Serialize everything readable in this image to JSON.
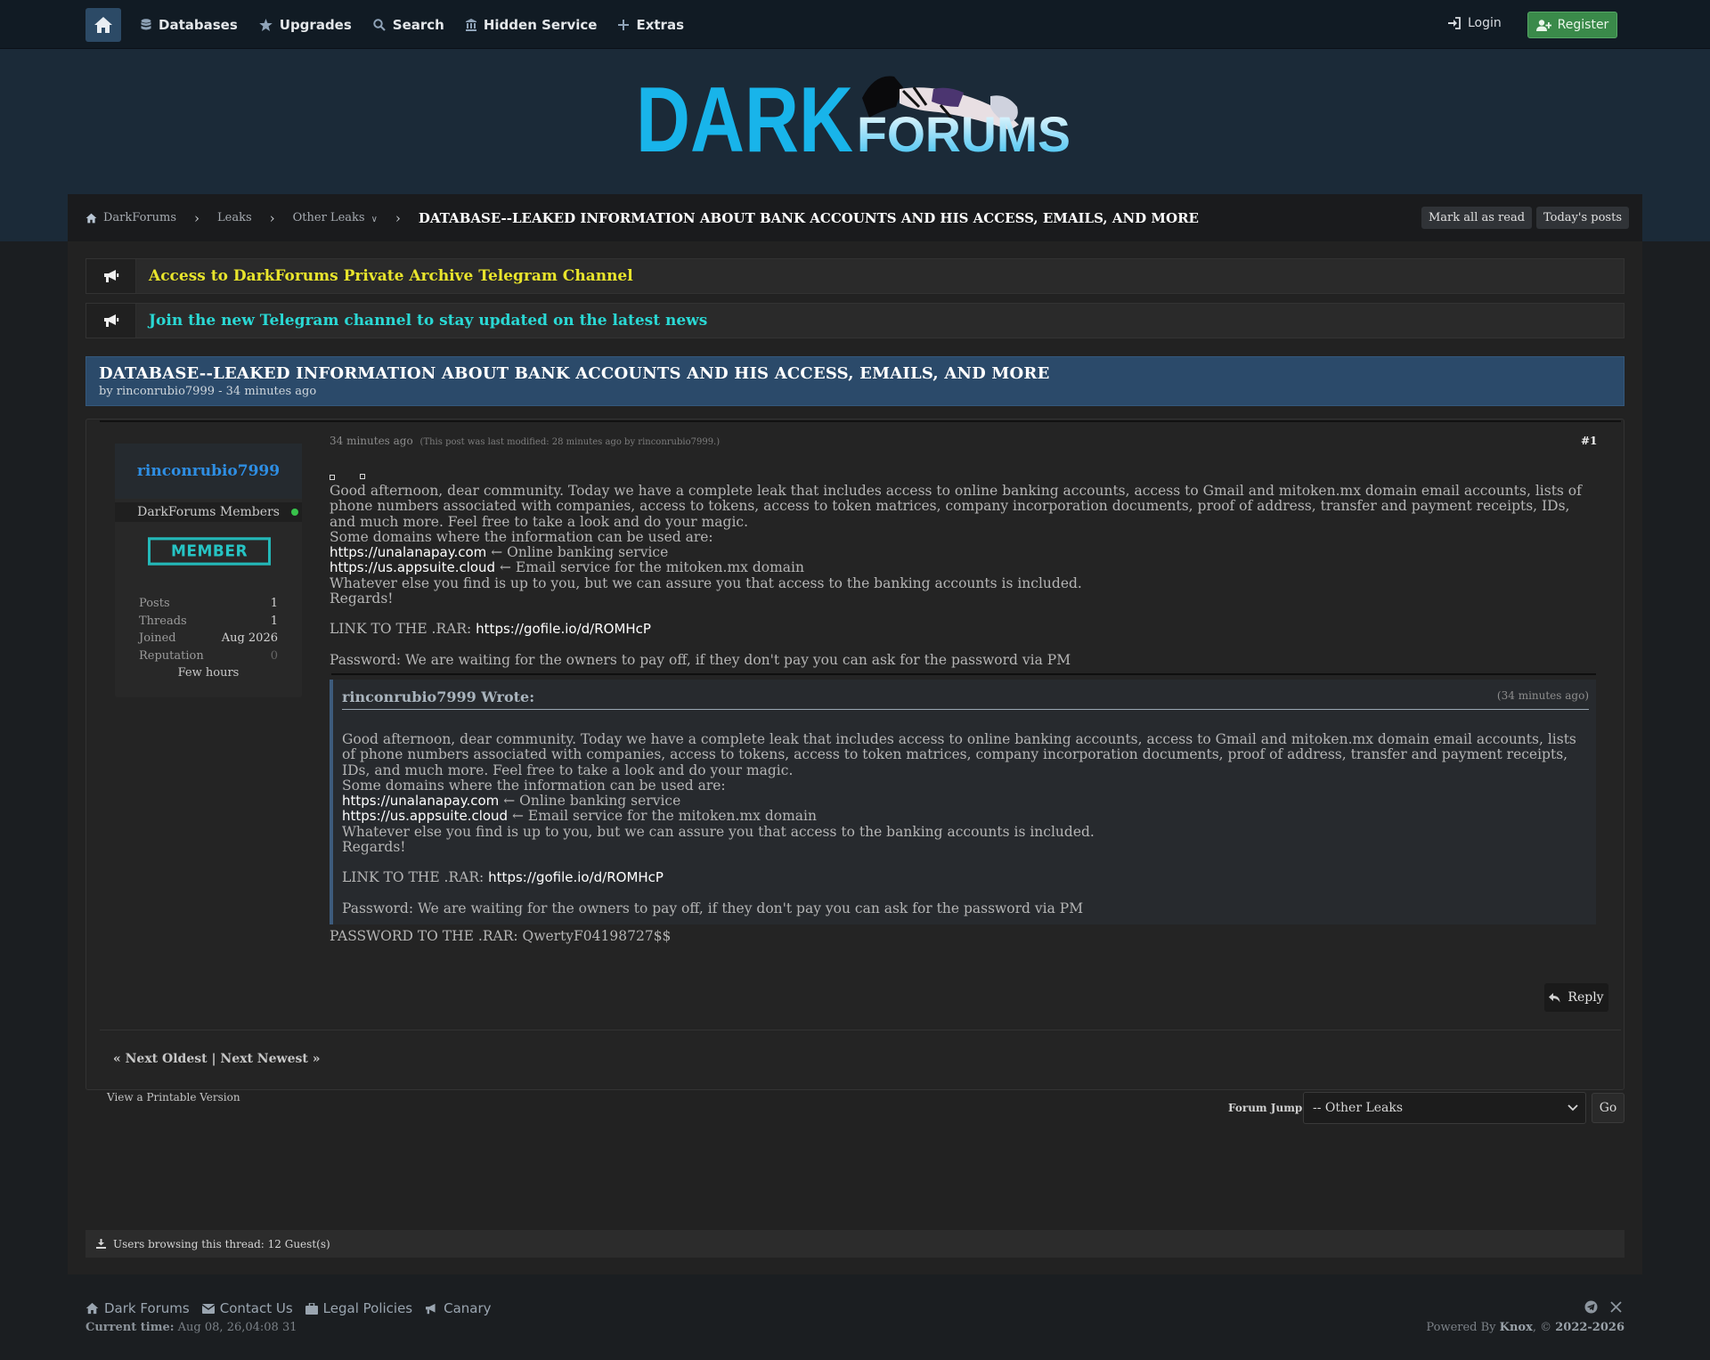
{
  "topnav": {
    "items": [
      {
        "label": "Databases",
        "icon": "database-icon"
      },
      {
        "label": "Upgrades",
        "icon": "star-icon"
      },
      {
        "label": "Search",
        "icon": "search-icon"
      },
      {
        "label": "Hidden Service",
        "icon": "building-icon"
      },
      {
        "label": "Extras",
        "icon": "plus-icon"
      }
    ],
    "login": "Login",
    "register": "Register"
  },
  "logo": {
    "dark": "DARK",
    "forums": "FORUMS"
  },
  "breadcrumb": {
    "items": [
      "DarkForums",
      "Leaks",
      "Other Leaks"
    ],
    "current": "DATABASE--LEAKED INFORMATION ABOUT BANK ACCOUNTS AND HIS ACCESS, EMAILS, AND MORE",
    "mark_read": "Mark all as read",
    "todays_posts": "Today's posts"
  },
  "announcements": [
    {
      "text": "Access to DarkForums Private Archive Telegram Channel",
      "color": "#e8e42c"
    },
    {
      "text": "Join the new Telegram channel to stay updated on the latest news",
      "color": "#2ad8d4"
    }
  ],
  "thread": {
    "title": "DATABASE--LEAKED INFORMATION ABOUT BANK ACCOUNTS AND HIS ACCESS, EMAILS, AND MORE",
    "byline": "by rinconrubio7999 - 34 minutes ago"
  },
  "user": {
    "name": "rinconrubio7999",
    "group": "DarkForums Members",
    "badge": "MEMBER",
    "stats": [
      {
        "label": "Posts",
        "value": "1"
      },
      {
        "label": "Threads",
        "value": "1"
      },
      {
        "label": "Joined",
        "value": "Aug 2026"
      },
      {
        "label": "Reputation",
        "value": "0"
      }
    ],
    "activity": "Few hours"
  },
  "post": {
    "time": "34 minutes ago",
    "modified": "(This post was last modified: 28 minutes ago by rinconrubio7999.)",
    "number": "#1",
    "intro": "Good afternoon, dear community. Today we have a complete leak that includes access to online banking accounts, access to Gmail and mitoken.mx domain email accounts, lists of phone numbers associated with companies, access to tokens, access to token matrices, company incorporation documents, proof of address, transfer and payment receipts, IDs, and much more. Feel free to take a look and do your magic.",
    "domains_intro": "Some domains where the information can be used are:",
    "domain1": "https://unalanapay.com",
    "domain1_desc": " ← Online banking service",
    "domain2": "https://us.appsuite.cloud",
    "domain2_desc": " ← Email service for the mitoken.mx domain",
    "whatever": "Whatever else you find is up to you, but we can assure you that access to the banking accounts is included.",
    "regards": "Regards!",
    "link_label": "LINK TO THE .RAR: ",
    "link": "https://gofile.io/d/ROMHcP",
    "password_note": "Password: We are waiting for the owners to pay off, if they don't pay you can ask for the password via PM",
    "quote_author": "rinconrubio7999 Wrote:",
    "quote_time": "(34 minutes ago)",
    "rar_password": "PASSWORD TO THE .RAR: QwertyF04198727$$",
    "reply": "Reply"
  },
  "pagination": {
    "text": "« Next Oldest | Next Newest »"
  },
  "printable": "View a Printable Version",
  "forum_jump": {
    "label": "Forum Jump:",
    "selected": "-- Other Leaks",
    "go": "Go"
  },
  "browsing": "Users browsing this thread: 12 Guest(s)",
  "footer": {
    "links": [
      "Dark Forums",
      "Contact Us",
      "Legal Policies",
      "Canary"
    ],
    "current_time_label": "Current time:",
    "current_time": "Aug 08, 26,04:08 31",
    "powered_prefix": "Powered By ",
    "powered_brand": "Knox",
    "powered_suffix": ", © ",
    "powered_years": "2022-2026"
  }
}
